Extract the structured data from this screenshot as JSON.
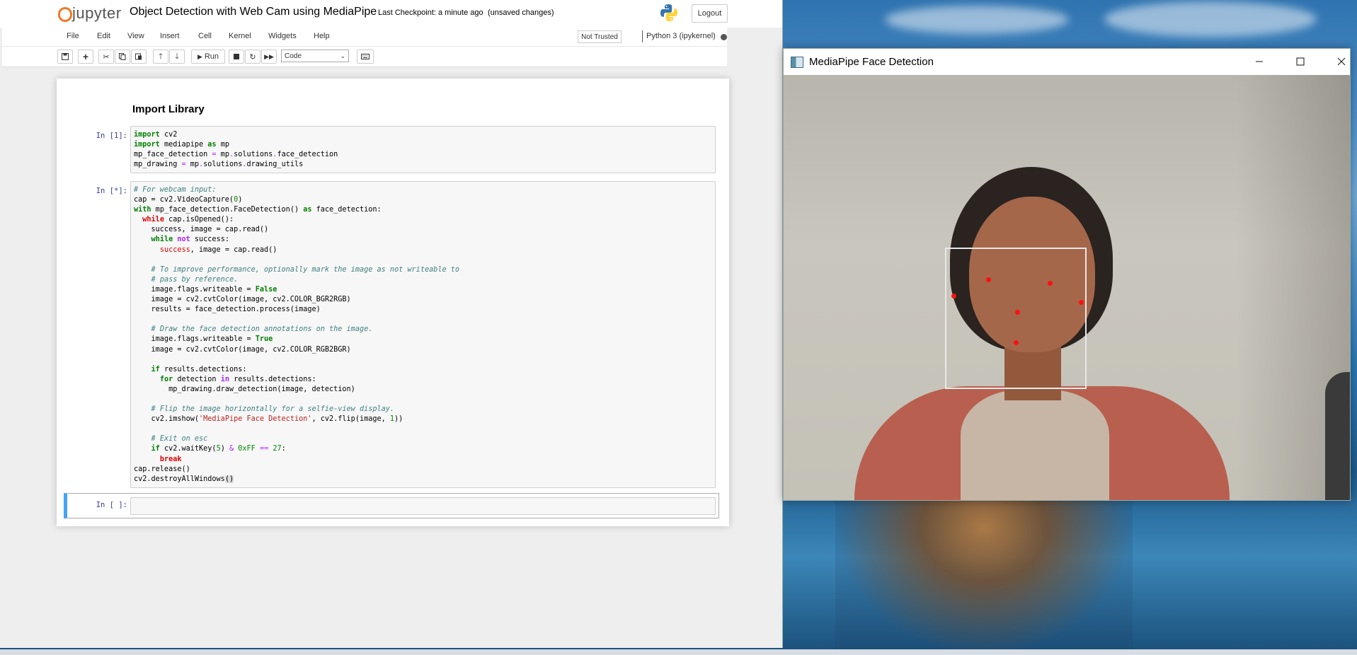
{
  "jupyter": {
    "logo_text": "jupyter",
    "notebook_title": "Object Detection with Web Cam using MediaPipe",
    "checkpoint": "Last Checkpoint: a minute ago",
    "unsaved": "(unsaved changes)",
    "logout_label": "Logout",
    "menu": [
      "File",
      "Edit",
      "View",
      "Insert",
      "Cell",
      "Kernel",
      "Widgets",
      "Help"
    ],
    "trust_status": "Not Trusted",
    "kernel_name": "Python 3 (ipykernel)",
    "toolbar": {
      "run_label": "Run",
      "cell_type": "Code",
      "icons": [
        "save-icon",
        "plus-icon",
        "cut-icon",
        "copy-icon",
        "paste-icon",
        "arrow-up-icon",
        "arrow-down-icon",
        "stop-icon",
        "restart-icon",
        "fast-forward-icon",
        "keyboard-icon"
      ]
    },
    "heading": "Import Library",
    "cells": [
      {
        "prompt": "In [1]:"
      },
      {
        "prompt": "In [*]:"
      },
      {
        "prompt": "In [ ]:"
      }
    ]
  },
  "mediapipe_window": {
    "title": "MediaPipe Face Detection",
    "controls": [
      "minimize-icon",
      "maximize-icon",
      "close-icon"
    ]
  },
  "colors": {
    "jupyter_orange": "#f37726",
    "prompt_blue": "#303f9f",
    "selected_cell_border": "#42a5f5",
    "keypoint_red": "#ff1010",
    "detection_box": "#e8e8e8"
  }
}
